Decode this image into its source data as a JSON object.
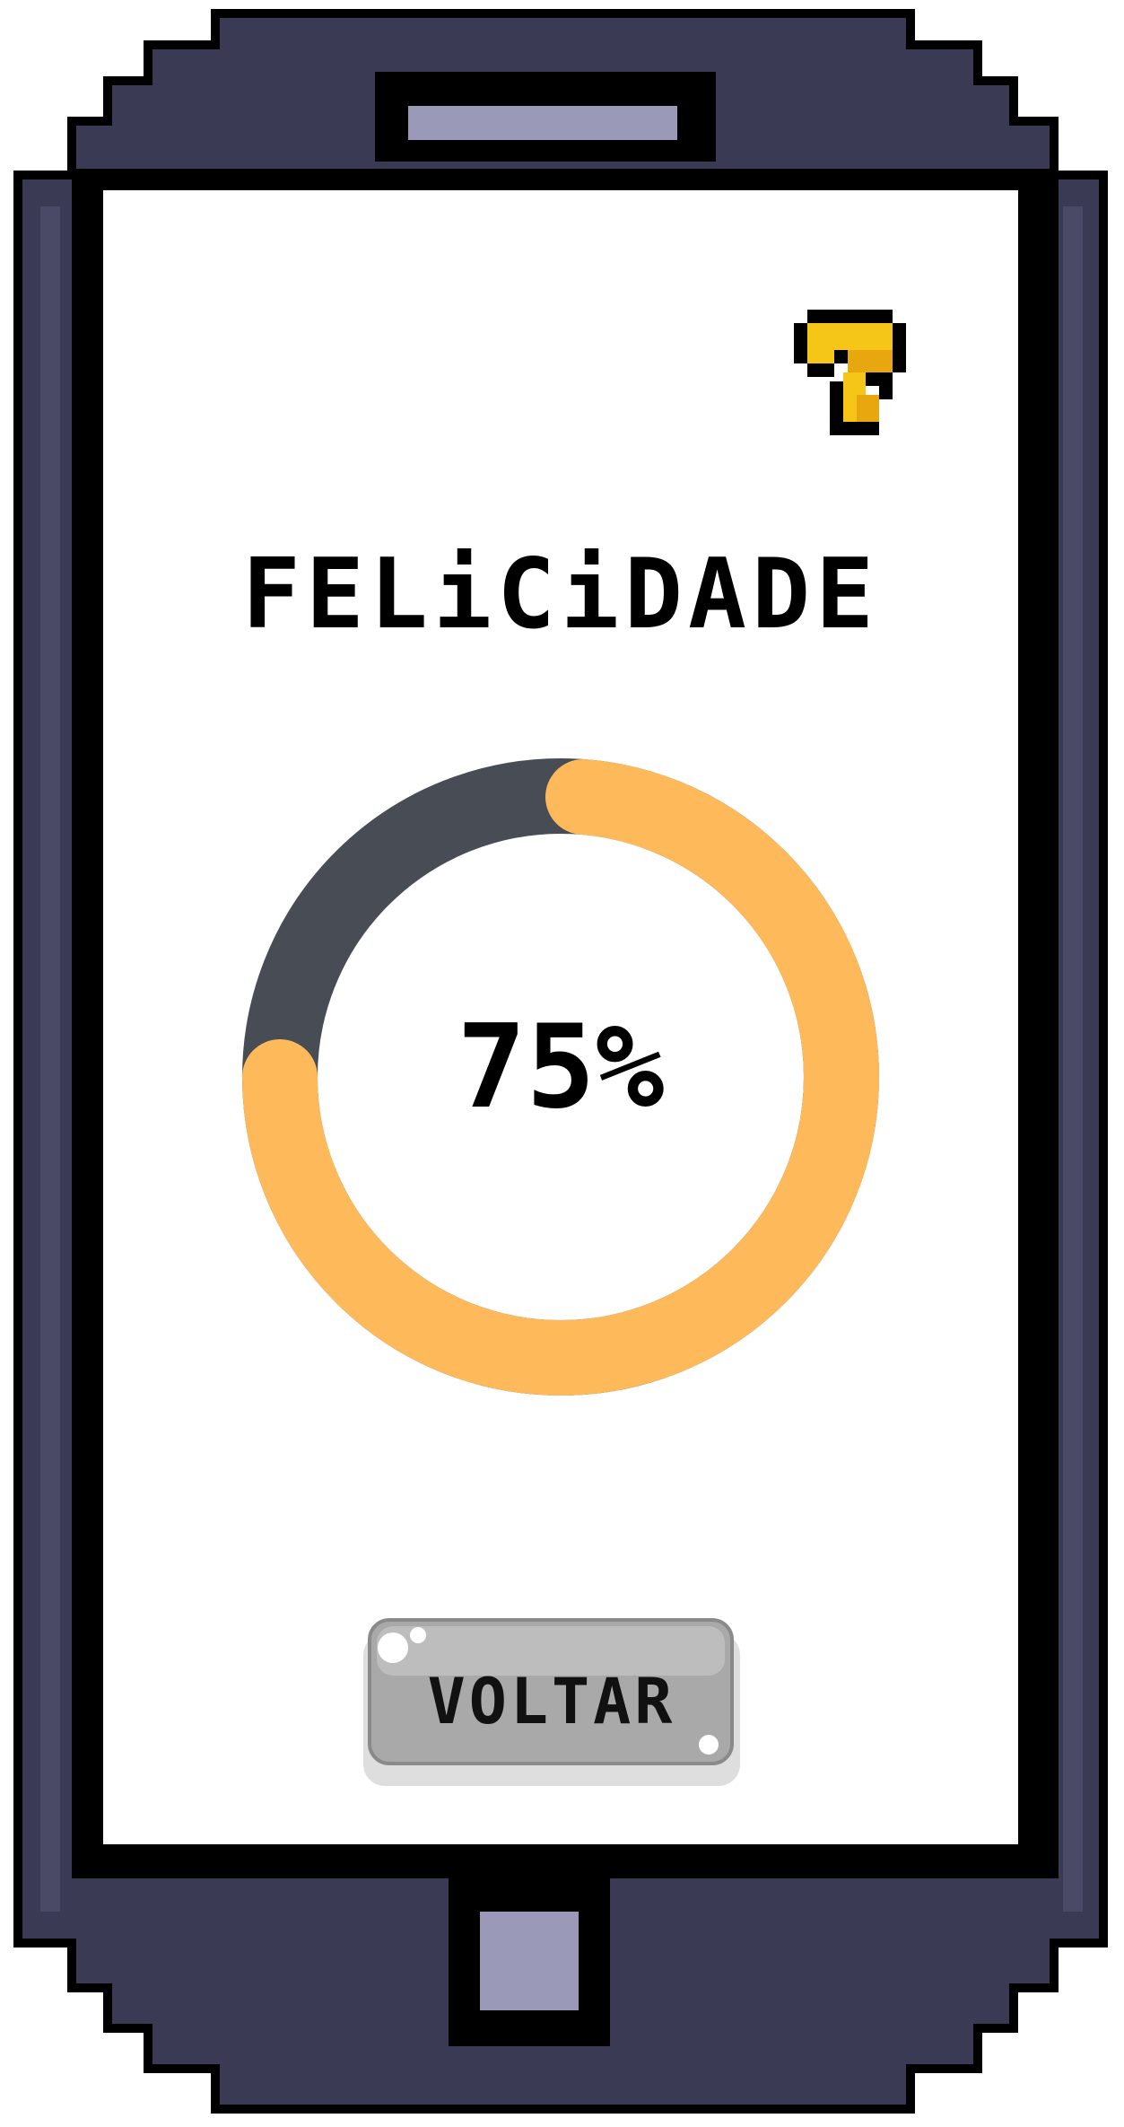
{
  "screen": {
    "title": "FELiCiDADE",
    "happiness": {
      "value_percent": 75,
      "label": "75%"
    },
    "back_button": {
      "label": "VOLTAR"
    },
    "help_button": {
      "icon": "question-mark-icon"
    }
  },
  "colors": {
    "phone_body": "#3b3a54",
    "phone_highlight": "#4a4a66",
    "phone_outline": "#000000",
    "phone_buttons": "#9a9ab8",
    "screen_bg": "#ffffff",
    "ring_fill": "#fdb95a",
    "ring_track": "#474c55",
    "help_icon": "#f5c518",
    "button_face": "#a9a9a9"
  }
}
